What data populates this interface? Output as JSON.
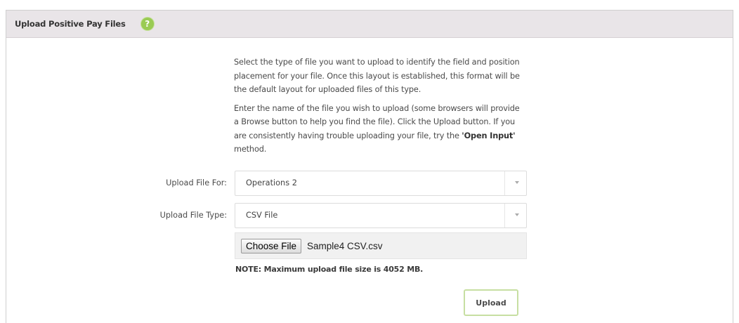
{
  "header": {
    "title": "Upload Positive Pay Files",
    "help_icon_glyph": "?",
    "help_icon": "question-mark-icon",
    "help_color": "#9acb54",
    "header_bg": "#e9e5e8"
  },
  "instructions": {
    "paragraph1": "Select the type of file you want to upload to identify the field and position placement for your file. Once this layout is established, this format will be the default layout for uploaded files of this type.",
    "paragraph2_prefix": "Enter the name of the file you wish to upload (some browsers will provide a Browse button to help you find the file). Click the Upload button. If you are consistently having trouble uploading your file, try the ",
    "paragraph2_link": "'Open Input'",
    "paragraph2_suffix": " method."
  },
  "form": {
    "upload_for": {
      "label": "Upload File For:",
      "value": "Operations 2"
    },
    "upload_type": {
      "label": "Upload File Type:",
      "value": "CSV File"
    },
    "file": {
      "button_label": "Choose File",
      "file_name": "Sample4 CSV.csv"
    },
    "note": "NOTE: Maximum upload file size is 4052 MB.",
    "upload_button": "Upload",
    "upload_border_color": "#c7dfa2"
  }
}
